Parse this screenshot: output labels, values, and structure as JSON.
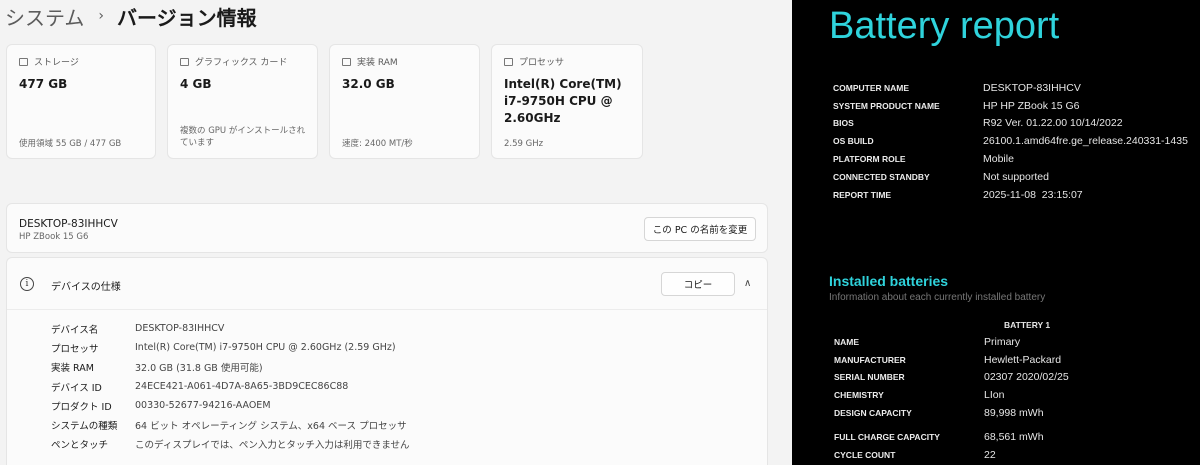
{
  "settings": {
    "breadcrumb": {
      "parent": "システム",
      "separator": "›",
      "current": "バージョン情報"
    },
    "cards": [
      {
        "label": "ストレージ",
        "value": "477 GB",
        "sub": "使用領域 55 GB / 477 GB"
      },
      {
        "label": "グラフィックス カード",
        "value": "4 GB",
        "sub": "複数の GPU がインストールされています"
      },
      {
        "label": "実装 RAM",
        "value": "32.0 GB",
        "sub": "速度: 2400 MT/秒"
      },
      {
        "label": "プロセッサ",
        "value": "Intel(R) Core(TM) i7-9750H CPU @ 2.60GHz",
        "sub": "2.59 GHz"
      }
    ],
    "device": {
      "name": "DESKTOP-83IHHCV",
      "model": "HP ZBook 15 G6",
      "rename_label": "この PC の名前を変更"
    },
    "specs": {
      "title": "デバイスの仕様",
      "copy_label": "コピー",
      "rows": [
        {
          "label": "デバイス名",
          "value": "DESKTOP-83IHHCV"
        },
        {
          "label": "プロセッサ",
          "value": "Intel(R) Core(TM) i7-9750H CPU @ 2.60GHz (2.59 GHz)"
        },
        {
          "label": "実装 RAM",
          "value": "32.0 GB (31.8 GB 使用可能)"
        },
        {
          "label": "デバイス ID",
          "value": "24ECE421-A061-4D7A-8A65-3BD9CEC86C88"
        },
        {
          "label": "プロダクト ID",
          "value": "00330-52677-94216-AAOEM"
        },
        {
          "label": "システムの種類",
          "value": "64 ビット オペレーティング システム、x64 ベース プロセッサ"
        },
        {
          "label": "ペンとタッチ",
          "value": "このディスプレイでは、ペン入力とタッチ入力は利用できません"
        }
      ]
    }
  },
  "battery_report": {
    "title": "Battery report",
    "system": [
      {
        "key": "COMPUTER NAME",
        "value": "DESKTOP-83IHHCV"
      },
      {
        "key": "SYSTEM PRODUCT NAME",
        "value": "HP HP ZBook 15 G6"
      },
      {
        "key": "BIOS",
        "value": "R92 Ver. 01.22.00 10/14/2022"
      },
      {
        "key": "OS BUILD",
        "value": "26100.1.amd64fre.ge_release.240331-1435"
      },
      {
        "key": "PLATFORM ROLE",
        "value": "Mobile"
      },
      {
        "key": "CONNECTED STANDBY",
        "value": "Not supported"
      },
      {
        "key": "REPORT TIME",
        "value": "2025-11-08  23:15:07"
      }
    ],
    "installed": {
      "title": "Installed batteries",
      "subtitle": "Information about each currently installed battery",
      "column": "BATTERY 1",
      "rows": [
        {
          "key": "NAME",
          "value": "Primary"
        },
        {
          "key": "MANUFACTURER",
          "value": "Hewlett-Packard"
        },
        {
          "key": "SERIAL NUMBER",
          "value": "02307 2020/02/25"
        },
        {
          "key": "CHEMISTRY",
          "value": "LIon"
        },
        {
          "key": "DESIGN CAPACITY",
          "value": "89,998 mWh"
        },
        {
          "key": "FULL CHARGE CAPACITY",
          "value": "68,561 mWh"
        },
        {
          "key": "CYCLE COUNT",
          "value": "22"
        }
      ]
    }
  },
  "colors": {
    "accent_cyan": "#2fd3dc",
    "settings_bg": "#f3f3f3",
    "report_bg": "#000000"
  }
}
